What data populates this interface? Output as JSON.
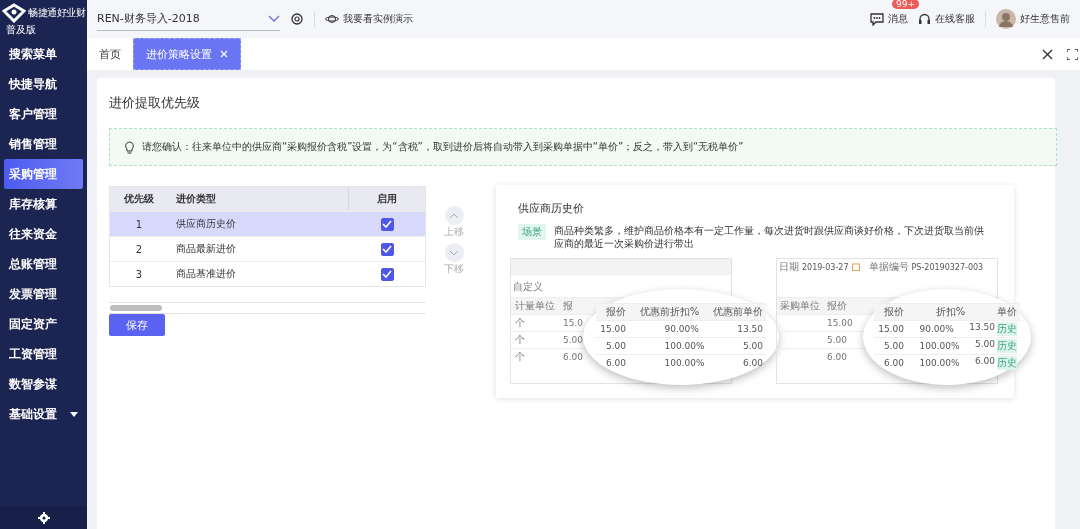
{
  "app": {
    "logo_text": "畅捷通好业财",
    "edition": "普及版"
  },
  "sidebar": {
    "items": [
      {
        "label": "搜索菜单",
        "selected": false,
        "expandable": false
      },
      {
        "label": "快捷导航",
        "selected": false,
        "expandable": false
      },
      {
        "label": "客户管理",
        "selected": false,
        "expandable": false
      },
      {
        "label": "销售管理",
        "selected": false,
        "expandable": false
      },
      {
        "label": "采购管理",
        "selected": true,
        "expandable": false
      },
      {
        "label": "库存核算",
        "selected": false,
        "expandable": false
      },
      {
        "label": "往来资金",
        "selected": false,
        "expandable": false
      },
      {
        "label": "总账管理",
        "selected": false,
        "expandable": false
      },
      {
        "label": "发票管理",
        "selected": false,
        "expandable": false
      },
      {
        "label": "固定资产",
        "selected": false,
        "expandable": false
      },
      {
        "label": "工资管理",
        "selected": false,
        "expandable": false
      },
      {
        "label": "数智参谋",
        "selected": false,
        "expandable": false
      },
      {
        "label": "基础设置",
        "selected": false,
        "expandable": true
      }
    ]
  },
  "topbar": {
    "account": "REN-财务导入-2018",
    "demo_link": "我要看实例演示",
    "messages": {
      "label": "消息",
      "badge": "99+"
    },
    "support": "在线客服",
    "user": "好生意售前"
  },
  "tabs": [
    {
      "label": "首页",
      "selected": false,
      "closable": false
    },
    {
      "label": "进价策略设置",
      "selected": true,
      "closable": true
    }
  ],
  "page": {
    "title": "进价提取优先级",
    "notice": "请您确认：往来单位中的供应商“采购报价含税”设置，为“含税”，取到进价后将自动带入到采购单据中“单价”；反之，带入到“无税单价”",
    "table": {
      "columns": [
        "优先级",
        "进价类型",
        "启用"
      ],
      "rows": [
        {
          "priority": "1",
          "type": "供应商历史价",
          "enabled": true,
          "selected": true
        },
        {
          "priority": "2",
          "type": "商品最新进价",
          "enabled": true,
          "selected": false
        },
        {
          "priority": "3",
          "type": "商品基准进价",
          "enabled": true,
          "selected": false
        }
      ]
    },
    "move_up": "上移",
    "move_down": "下移",
    "save": "保存",
    "detail": {
      "title": "供应商历史价",
      "tag": "场景",
      "description": "商品种类繁多，维护商品价格本有一定工作量，每次进货时跟供应商谈好价格，下次进货取当前供应商的最近一次采购价进行带出",
      "before": {
        "field": "自定义",
        "columns": [
          "计量单位",
          "报"
        ],
        "rows": [
          [
            "个",
            "15.0"
          ],
          [
            "个",
            "5.00"
          ],
          [
            "个",
            "6.00"
          ]
        ],
        "zoom": {
          "columns": [
            "报价",
            "优惠前折扣%",
            "优惠前单价"
          ],
          "rows": [
            [
              "15.00",
              "90.00%",
              "13.50"
            ],
            [
              "5.00",
              "100.00%",
              "5.00"
            ],
            [
              "6.00",
              "100.00%",
              "6.00"
            ]
          ]
        }
      },
      "after": {
        "date_label": "日期",
        "date": "2019-03-27",
        "number_label": "单据编号",
        "number": "PS-20190327-003",
        "columns": [
          "采购单位",
          "报价"
        ],
        "rows": [
          [
            "15.00"
          ],
          [
            "5.00"
          ],
          [
            "6.00"
          ]
        ],
        "zoom": {
          "columns": [
            "报价",
            "折扣%",
            "单价"
          ],
          "rows": [
            [
              "15.00",
              "90.00%",
              "13.50"
            ],
            [
              "5.00",
              "100.00%",
              "5.00"
            ],
            [
              "6.00",
              "100.00%",
              "6.00"
            ]
          ],
          "tags": [
            "历史",
            "历史",
            "历史"
          ]
        }
      }
    }
  }
}
